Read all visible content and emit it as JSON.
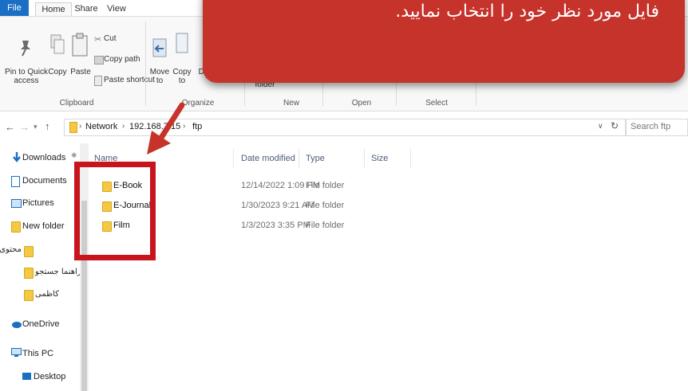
{
  "ribbon": {
    "tabs": {
      "file": "File",
      "home": "Home",
      "share": "Share",
      "view": "View"
    },
    "clipboard": {
      "pin_label": "Pin to Quick access",
      "copy_label": "Copy",
      "paste_label": "Paste",
      "cut_label": "Cut",
      "copy_path_label": "Copy path",
      "paste_shortcut_label": "Paste shortcut",
      "group_label": "Clipboard"
    },
    "organize": {
      "move_to_label": "Move to",
      "copy_to_label": "Copy to",
      "delete_label": "De",
      "group_label": "Organize"
    },
    "new": {
      "folder_label": "folder",
      "group_label": "New"
    },
    "open": {
      "group_label": "Open"
    },
    "select": {
      "group_label": "Select"
    }
  },
  "address": {
    "segments": [
      "Network",
      "192.168.7.15",
      "ftp"
    ],
    "search_placeholder": "Search ftp"
  },
  "nav": {
    "items": [
      {
        "label": "Downloads",
        "icon": "download-icon"
      },
      {
        "label": "Documents",
        "icon": "document-icon"
      },
      {
        "label": "Pictures",
        "icon": "pictures-icon"
      },
      {
        "label": "New folder",
        "icon": "folder-icon"
      },
      {
        "label": "محتوی پایان نامه",
        "icon": "folder-icon"
      },
      {
        "label": "راهنما جستجو",
        "icon": "folder-icon"
      },
      {
        "label": "کاظمی",
        "icon": "folder-icon"
      },
      {
        "label": "OneDrive",
        "icon": "onedrive-icon"
      },
      {
        "label": "This PC",
        "icon": "computer-icon"
      },
      {
        "label": "Desktop",
        "icon": "desktop-icon"
      }
    ]
  },
  "file_list": {
    "columns": {
      "name": "Name",
      "date": "Date modified",
      "type": "Type",
      "size": "Size"
    },
    "rows": [
      {
        "name": "E-Book",
        "date": "12/14/2022 1:09 PM",
        "type": "File folder"
      },
      {
        "name": "E-Journals",
        "date": "1/30/2023 9:21 AM",
        "type": "File folder"
      },
      {
        "name": "Film",
        "date": "1/3/2023 3:35 PM",
        "type": "File folder"
      }
    ]
  },
  "callout": {
    "text": "فایل مورد نظر خود را انتخاب نمایید."
  },
  "colors": {
    "callout": "#c6332b",
    "highlight": "#c8141d",
    "accent": "#1a6fc4"
  }
}
